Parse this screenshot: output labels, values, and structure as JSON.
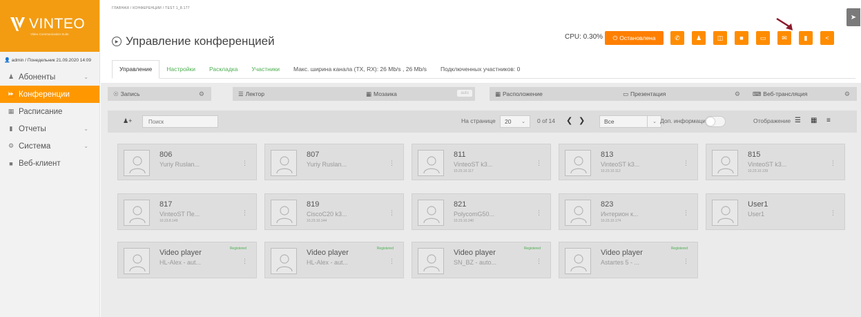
{
  "logo": {
    "text": "VINTEO",
    "subtitle": "Video Communication Suite",
    "color": "#f39c12"
  },
  "user": {
    "line": "admin / Понедельник 21.09.2020 14:09"
  },
  "sidebar": {
    "items": [
      {
        "label": "Абоненты",
        "icon": "users-icon",
        "has_chevron": true,
        "active": false
      },
      {
        "label": "Конференции",
        "icon": "forward-icon",
        "has_chevron": false,
        "active": true
      },
      {
        "label": "Расписание",
        "icon": "calendar-icon",
        "has_chevron": false,
        "active": false
      },
      {
        "label": "Отчеты",
        "icon": "book-icon",
        "has_chevron": true,
        "active": false
      },
      {
        "label": "Система",
        "icon": "gears-icon",
        "has_chevron": true,
        "active": false
      },
      {
        "label": "Веб-клиент",
        "icon": "video-icon",
        "has_chevron": false,
        "active": false
      }
    ]
  },
  "header": {
    "breadcrumb": "ГЛАВНАЯ / КОНФЕРЕНЦИИ / TEST 1_8.177",
    "title": "Управление конференцией",
    "cpu": "CPU: 0.30%",
    "status_button": "Остановлена",
    "accent": "#ff8c00"
  },
  "tabs": [
    {
      "label": "Управление",
      "active": true
    },
    {
      "label": "Настройки",
      "active": false
    },
    {
      "label": "Раскладка",
      "active": false
    },
    {
      "label": "Участники",
      "active": false
    }
  ],
  "tab_info": {
    "bandwidth": "Макс. ширина канала (TX, RX): 26 Mb/s , 26 Mb/s",
    "connected": "Подключенных участников: 0"
  },
  "controls": {
    "record": "Запись",
    "lecturer": "Лектор",
    "mosaic": "Мозаика",
    "mosaic_mode": "auto",
    "layout": "Расположение",
    "presentation": "Презентация",
    "webcast": "Веб-трансляция"
  },
  "toolbar": {
    "search_placeholder": "Поиск",
    "per_page_label": "На странице",
    "per_page_value": "20",
    "pagination": "0 of 14",
    "filter_value": "Все",
    "extra_info_label": "Доп. информация",
    "view_label": "Отображение"
  },
  "participants": [
    {
      "num": "806",
      "name": "Yuriy Ruslan...",
      "ip": "",
      "registered": ""
    },
    {
      "num": "807",
      "name": "Yuriy Ruslan...",
      "ip": "",
      "registered": ""
    },
    {
      "num": "811",
      "name": "VinteoST k3...",
      "ip": "10.23.10.117",
      "registered": ""
    },
    {
      "num": "813",
      "name": "VinteoST k3...",
      "ip": "10.23.10.112",
      "registered": ""
    },
    {
      "num": "815",
      "name": "VinteoST k3...",
      "ip": "10.23.10.139",
      "registered": ""
    },
    {
      "num": "817",
      "name": "VinteoST Пе...",
      "ip": "10.23.8.149",
      "registered": ""
    },
    {
      "num": "819",
      "name": "CiscoC20 k3...",
      "ip": "10.23.10.144",
      "registered": ""
    },
    {
      "num": "821",
      "name": "PolycomG50...",
      "ip": "10.23.10.240",
      "registered": ""
    },
    {
      "num": "823",
      "name": "Интерион к...",
      "ip": "10.23.10.174",
      "registered": ""
    },
    {
      "num": "User1",
      "name": "User1",
      "ip": "",
      "registered": ""
    },
    {
      "num": "Video player",
      "name": "HL-Alex - aut...",
      "ip": "",
      "registered": "Registered"
    },
    {
      "num": "Video player",
      "name": "HL-Alex - aut...",
      "ip": "",
      "registered": "Registered"
    },
    {
      "num": "Video player",
      "name": "SN_BZ - auto...",
      "ip": "",
      "registered": "Registered"
    },
    {
      "num": "Video player",
      "name": "Astartes 5 - ...",
      "ip": "",
      "registered": "Registered"
    }
  ]
}
